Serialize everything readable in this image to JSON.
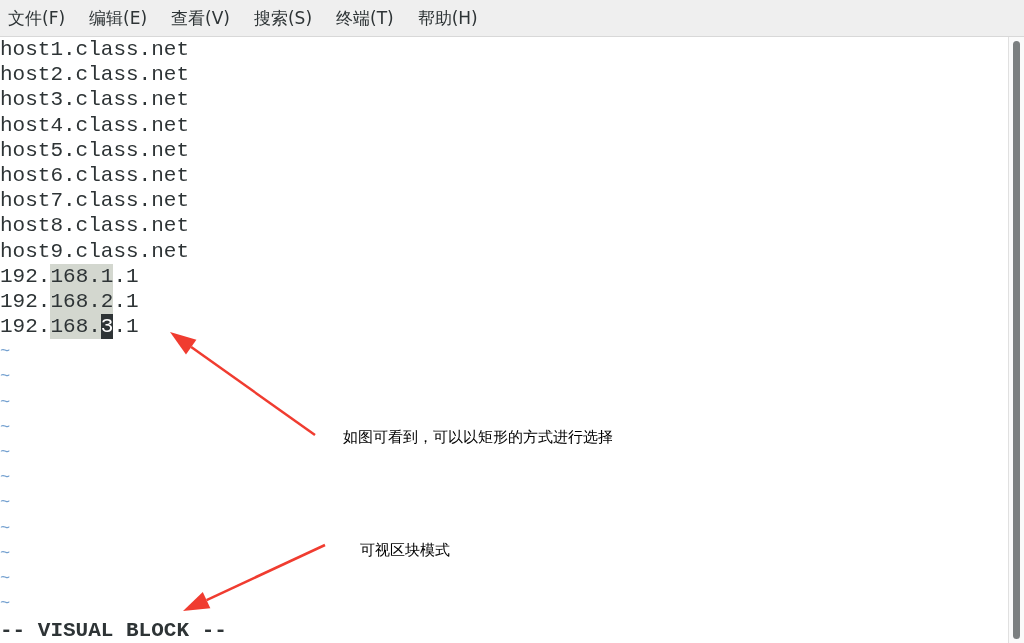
{
  "menu": [
    "文件(F)",
    "编辑(E)",
    "查看(V)",
    "搜索(S)",
    "终端(T)",
    "帮助(H)"
  ],
  "lines": [
    [
      {
        "kind": "plain",
        "text": "host1.class.net"
      }
    ],
    [
      {
        "kind": "plain",
        "text": "host2.class.net"
      }
    ],
    [
      {
        "kind": "plain",
        "text": "host3.class.net"
      }
    ],
    [
      {
        "kind": "plain",
        "text": "host4.class.net"
      }
    ],
    [
      {
        "kind": "plain",
        "text": "host5.class.net"
      }
    ],
    [
      {
        "kind": "plain",
        "text": "host6.class.net"
      }
    ],
    [
      {
        "kind": "plain",
        "text": "host7.class.net"
      }
    ],
    [
      {
        "kind": "plain",
        "text": "host8.class.net"
      }
    ],
    [
      {
        "kind": "plain",
        "text": "host9.class.net"
      }
    ],
    [
      {
        "kind": "plain",
        "text": "192."
      },
      {
        "kind": "selected",
        "text": "168.1"
      },
      {
        "kind": "plain",
        "text": ".1"
      }
    ],
    [
      {
        "kind": "plain",
        "text": "192."
      },
      {
        "kind": "selected",
        "text": "168.2"
      },
      {
        "kind": "plain",
        "text": ".1"
      }
    ],
    [
      {
        "kind": "plain",
        "text": "192."
      },
      {
        "kind": "selected",
        "text": "168."
      },
      {
        "kind": "cursor",
        "text": "3"
      },
      {
        "kind": "plain",
        "text": ".1"
      }
    ]
  ],
  "empty_lines": [
    "~",
    "~",
    "~",
    "~",
    "~",
    "~",
    "~",
    "~",
    "~",
    "~",
    "~"
  ],
  "status": "-- VISUAL BLOCK --",
  "annotations": [
    "如图可看到，可以以矩形的方式进行选择",
    "可视区块模式"
  ]
}
